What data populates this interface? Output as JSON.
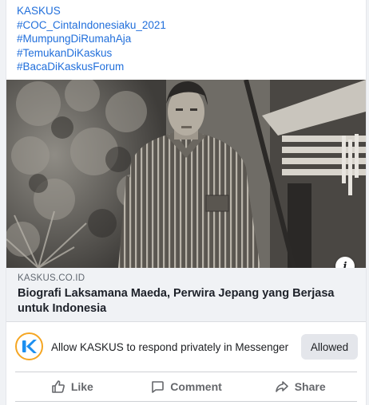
{
  "post": {
    "hashtags": [
      "KASKUS",
      "#COC_CintaIndonesiaku_2021",
      "#MumpungDiRumahAja",
      "#TemukanDiKaskus",
      "#BacaDiKaskusForum"
    ]
  },
  "link_preview": {
    "domain": "KASKUS.CO.ID",
    "title": "Biografi Laksamana Maeda, Perwira Jepang yang Berjasa untuk Indonesia",
    "info_icon": "info-icon"
  },
  "messenger": {
    "prompt": "Allow KASKUS to respond privately in Messenger",
    "button_label": "Allowed",
    "logo_letter": "K"
  },
  "actions": {
    "like": "Like",
    "comment": "Comment",
    "share": "Share"
  },
  "colors": {
    "link_blue": "#216fdb",
    "kaskus_blue": "#1c8ff0",
    "kaskus_ring": "#f5a623"
  }
}
